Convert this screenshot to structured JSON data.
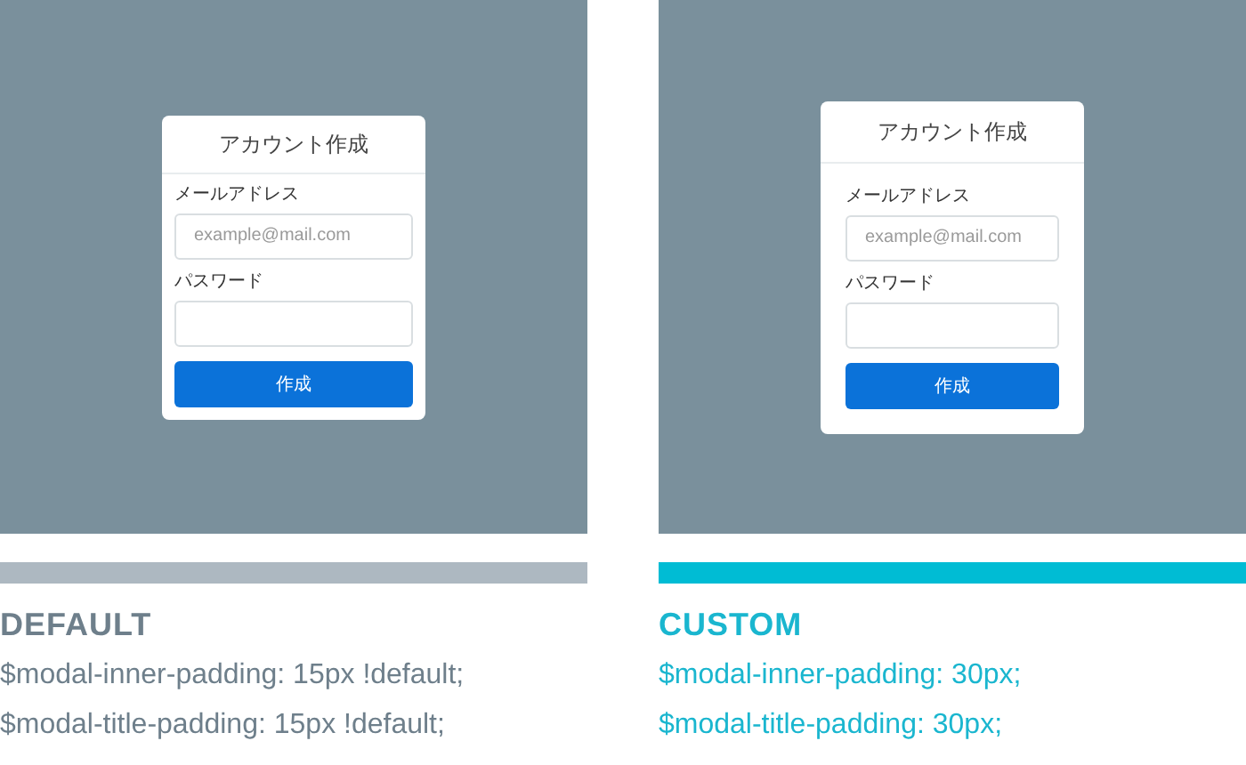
{
  "panels": [
    {
      "kind": "default",
      "color": "#adb8c1",
      "heading": "DEFAULT",
      "lines": [
        "$modal-inner-padding: 15px !default;",
        "$modal-title-padding: 15px !default;"
      ],
      "modal": {
        "title": "アカウント作成",
        "fields": [
          {
            "label": "メールアドレス",
            "placeholder": "example@mail.com"
          },
          {
            "label": "パスワード"
          }
        ],
        "button": "作成"
      }
    },
    {
      "kind": "custom",
      "color": "#00bcd4",
      "heading": "CUSTOM",
      "lines": [
        "$modal-inner-padding: 30px;",
        "$modal-title-padding: 30px;"
      ],
      "modal": {
        "title": "アカウント作成",
        "fields": [
          {
            "label": "メールアドレス",
            "placeholder": "example@mail.com"
          },
          {
            "label": "パスワード"
          }
        ],
        "button": "作成"
      }
    }
  ]
}
